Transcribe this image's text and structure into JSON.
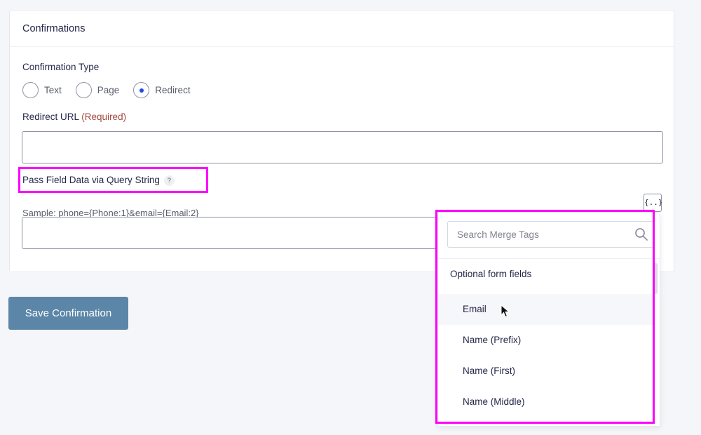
{
  "panel": {
    "title": "Confirmations",
    "confirmation_type": {
      "label": "Confirmation Type",
      "options": [
        "Text",
        "Page",
        "Redirect"
      ],
      "selected": "Redirect"
    },
    "redirect_url": {
      "label": "Redirect URL",
      "required_label": "(Required)",
      "value": ""
    },
    "query_string": {
      "label": "Pass Field Data via Query String",
      "help": "?",
      "sample": "Sample: phone={Phone:1}&email={Email:2}",
      "value": "",
      "merge_button": "{..}"
    }
  },
  "save_button": "Save Confirmation",
  "merge_tags": {
    "search_placeholder": "Search Merge Tags",
    "group_label": "Optional form fields",
    "items": [
      "Email",
      "Name (Prefix)",
      "Name (First)",
      "Name (Middle)"
    ],
    "hovered": "Email"
  },
  "colors": {
    "highlight": "#ff00ff",
    "save_button": "#5b86a8",
    "required": "#a1473f",
    "radio_selected": "#204ce5"
  }
}
